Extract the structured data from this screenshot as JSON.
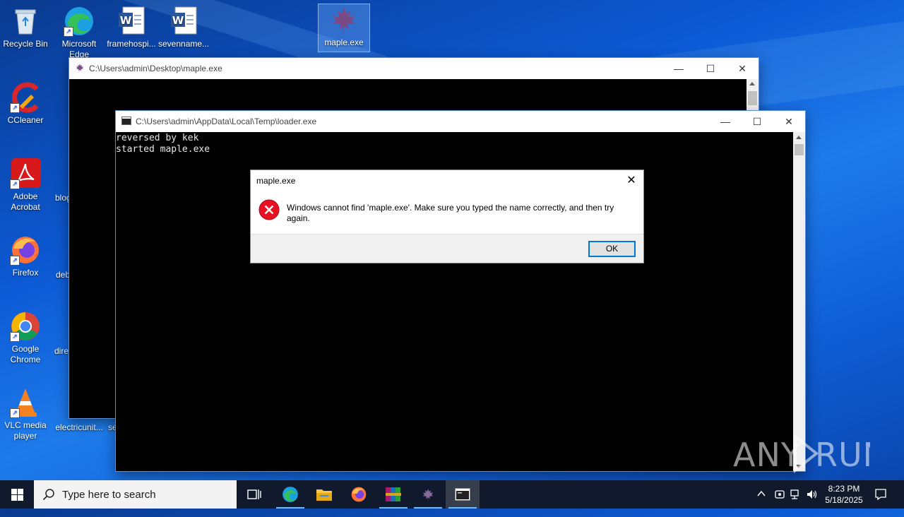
{
  "desktop": {
    "icons": [
      {
        "label": "Recycle Bin"
      },
      {
        "label": "Microsoft Edge"
      },
      {
        "label": "framehospi..."
      },
      {
        "label": "sevenname..."
      },
      {
        "label": "maple.exe"
      },
      {
        "label": "CCleaner"
      },
      {
        "label": "Adobe Acrobat"
      },
      {
        "label": "blog"
      },
      {
        "label": "Firefox"
      },
      {
        "label": "deb"
      },
      {
        "label": "Google Chrome"
      },
      {
        "label": "dire"
      },
      {
        "label": "VLC media player"
      },
      {
        "label": "electricunit..."
      },
      {
        "label": "se"
      }
    ]
  },
  "window_back": {
    "title": "C:\\Users\\admin\\Desktop\\maple.exe",
    "minimize": "—",
    "maximize": "☐",
    "close": "✕"
  },
  "window_front": {
    "title": "C:\\Users\\admin\\AppData\\Local\\Temp\\loader.exe",
    "minimize": "—",
    "maximize": "☐",
    "close": "✕",
    "console_lines": [
      "reversed by kek",
      "started maple.exe"
    ]
  },
  "dialog": {
    "title": "maple.exe",
    "message": "Windows cannot find 'maple.exe'. Make sure you typed the name correctly, and then try again.",
    "ok_label": "OK",
    "close": "✕"
  },
  "taskbar": {
    "search_placeholder": "Type here to search",
    "time": "8:23 PM",
    "date": "5/18/2025"
  },
  "watermark": "ANY▷RUN",
  "colors": {
    "accent": "#0078d7",
    "error": "#e81123",
    "taskbar": "#101a2c"
  }
}
